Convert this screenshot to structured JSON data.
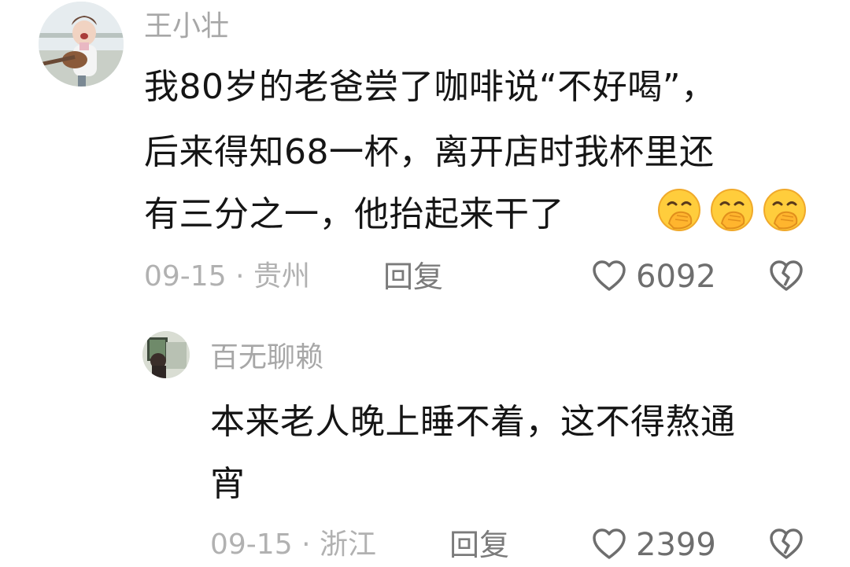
{
  "comments": [
    {
      "username": "王小壮",
      "lines": [
        "我80岁的老爸尝了咖啡说“不好喝”，",
        "后来得知68一杯，离开店时我杯里还",
        "有三分之一，他抬起来干了"
      ],
      "emojis": [
        "hand-over-mouth-emoji",
        "hand-over-mouth-emoji",
        "hand-over-mouth-emoji"
      ],
      "date": "09-15",
      "location": "贵州",
      "reply_label": "回复",
      "likes": "6092",
      "avatar_icon": "girl-with-guitar-avatar"
    },
    {
      "username": "百无聊赖",
      "lines": [
        "本来老人晚上睡不着，这不得熬通",
        "宵"
      ],
      "date": "09-15",
      "location": "浙江",
      "reply_label": "回复",
      "likes": "2399",
      "avatar_icon": "painting-avatar"
    }
  ],
  "meta_separator": "·",
  "icons": {
    "like": "heart-outline-icon",
    "dislike": "broken-heart-icon"
  },
  "colors": {
    "text": "#151515",
    "muted": "#a7a7a7",
    "icon": "#6e6e6e"
  }
}
